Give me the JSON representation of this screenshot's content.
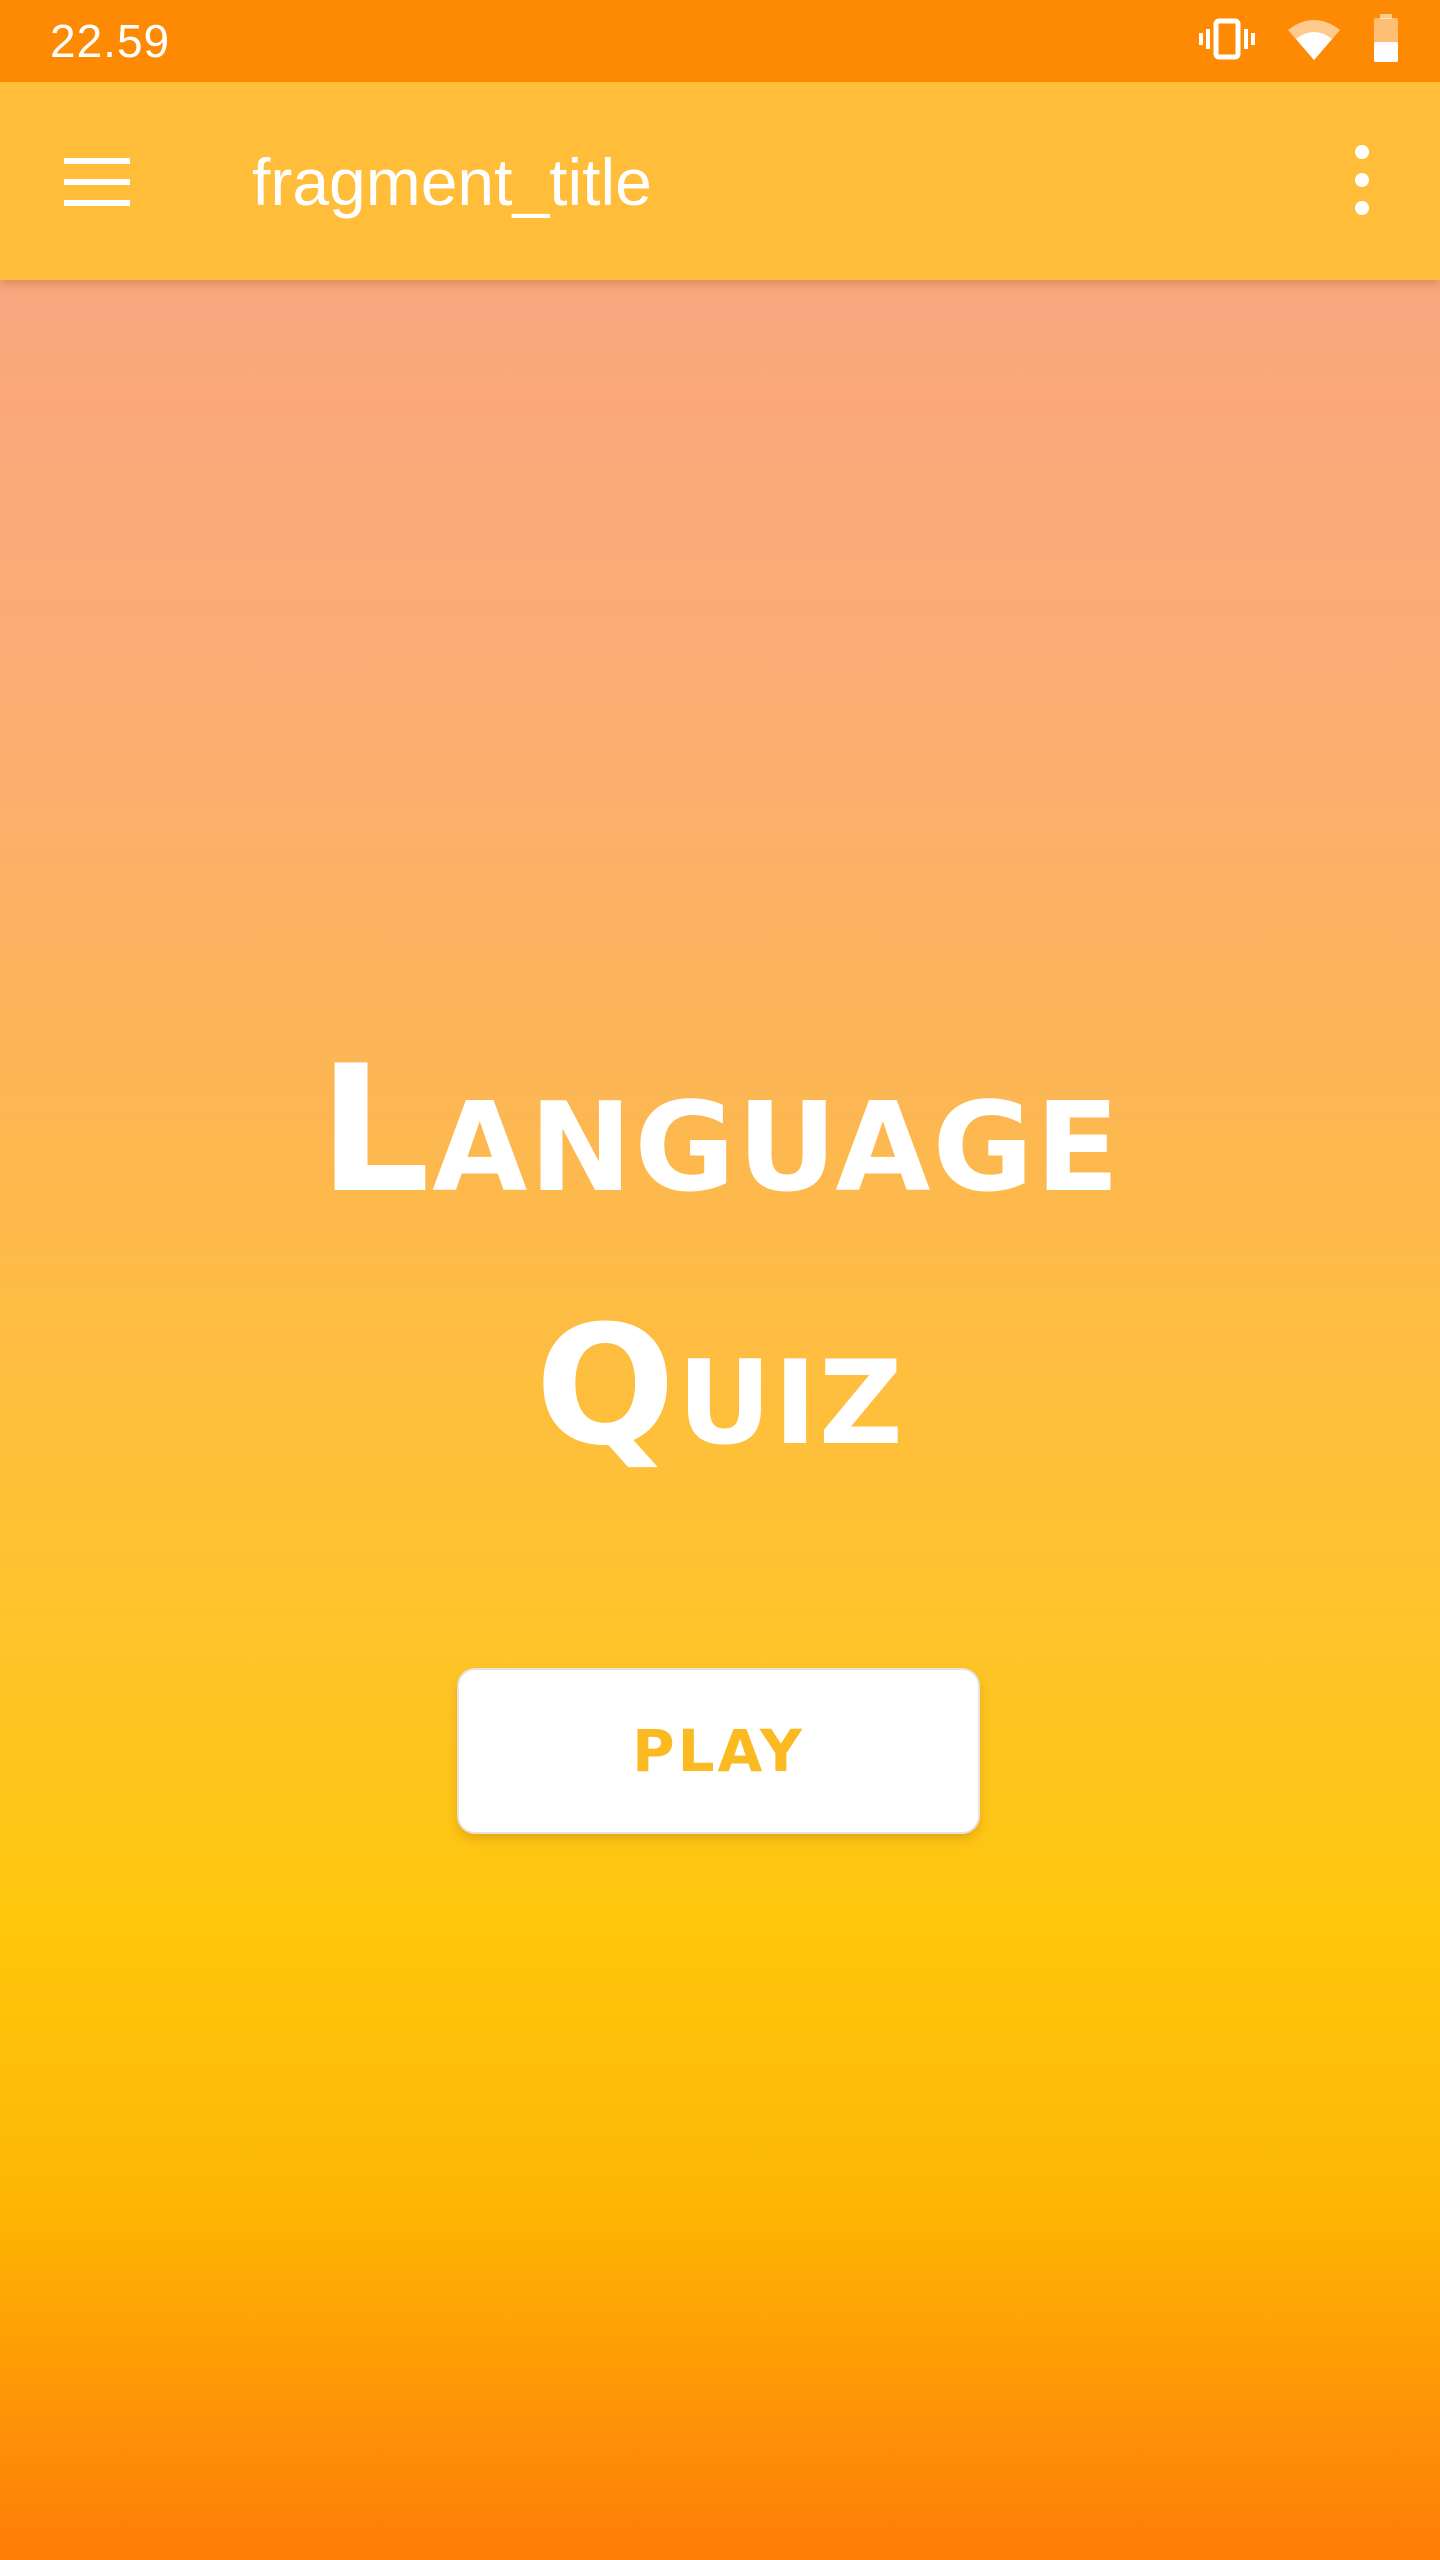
{
  "status_bar": {
    "time": "22.59",
    "icons": [
      "vibrate-icon",
      "wifi-icon",
      "battery-icon"
    ]
  },
  "app_bar": {
    "menu_icon": "hamburger-menu-icon",
    "title": "fragment_title",
    "overflow_icon": "more-vert-icon"
  },
  "main": {
    "title_line1": "Language",
    "title_line2": "Quiz",
    "play_label": "PLAY"
  },
  "colors": {
    "status_bar": "#fe8a04",
    "app_bar": "#ffbd3a",
    "play_text": "#fbba21",
    "gradient_top": "#f29a7c",
    "gradient_mid": "#fec70c",
    "gradient_bottom": "#fe7d06"
  }
}
